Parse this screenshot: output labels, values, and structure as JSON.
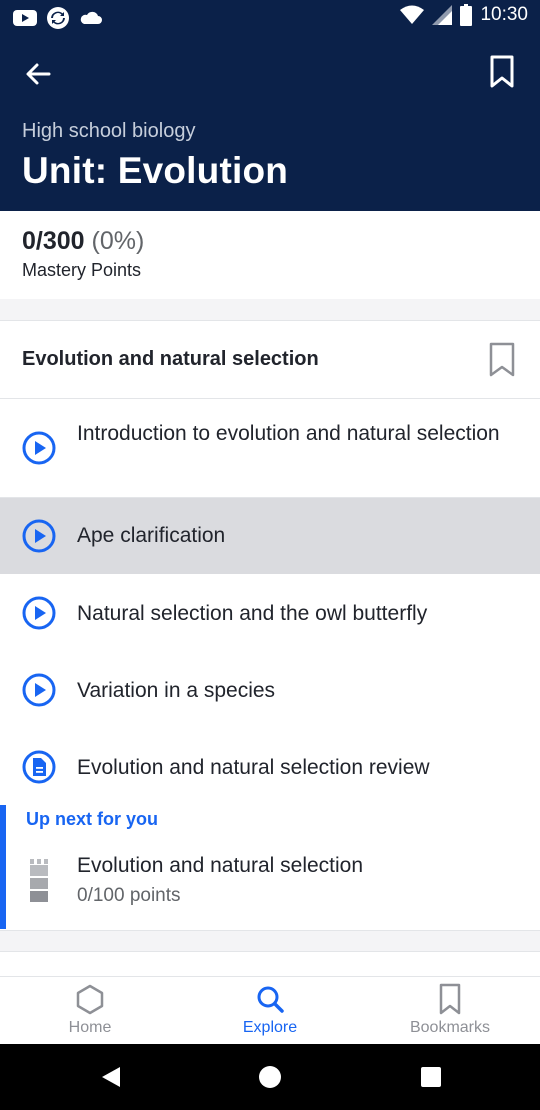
{
  "status_bar": {
    "time": "10:30"
  },
  "header": {
    "subtitle": "High school biology",
    "title": "Unit: Evolution"
  },
  "mastery": {
    "points": "0/300",
    "percent": "(0%)",
    "label": "Mastery Points"
  },
  "section": {
    "title": "Evolution and natural selection",
    "items": [
      {
        "label": "Introduction to evolution and natural selection",
        "icon": "play-circle-icon"
      },
      {
        "label": "Ape clarification",
        "icon": "play-circle-icon"
      },
      {
        "label": "Natural selection and the owl butterfly",
        "icon": "play-circle-icon"
      },
      {
        "label": "Variation in a species",
        "icon": "play-circle-icon"
      },
      {
        "label": "Evolution and natural selection review",
        "icon": "article-icon"
      }
    ]
  },
  "up_next": {
    "heading": "Up next for you",
    "title": "Evolution and natural selection",
    "points": "0/100 points"
  },
  "bottom_nav": {
    "tabs": [
      {
        "label": "Home",
        "icon": "home-hexagon-icon"
      },
      {
        "label": "Explore",
        "icon": "search-icon",
        "active": true
      },
      {
        "label": "Bookmarks",
        "icon": "bookmark-icon"
      }
    ]
  },
  "colors": {
    "header_bg": "#0b2149",
    "accent": "#1865f2",
    "highlight_row": "#dadbdf"
  }
}
